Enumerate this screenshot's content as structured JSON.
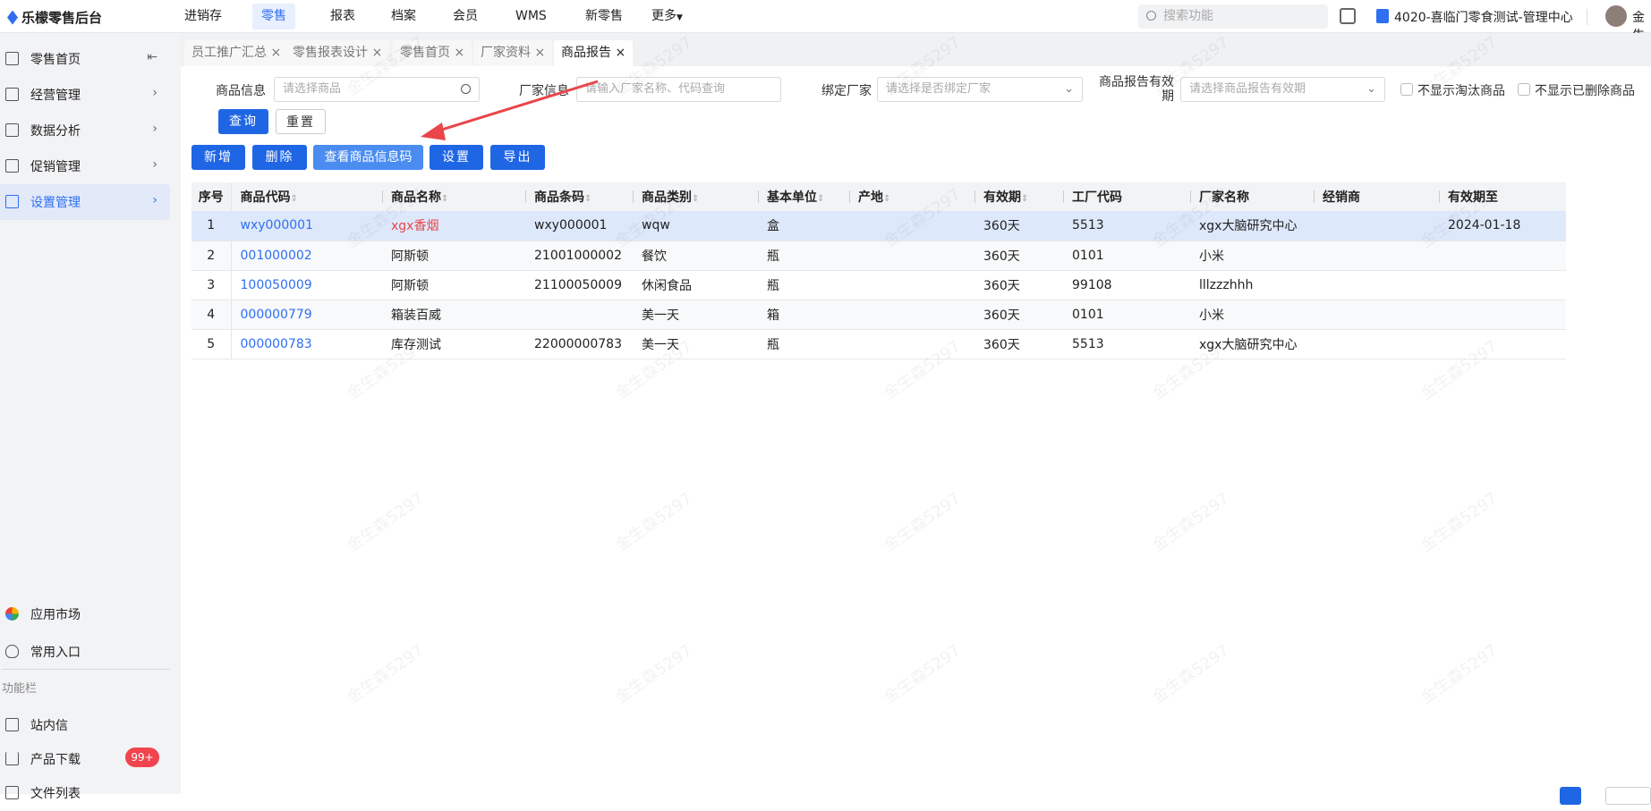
{
  "app": {
    "title": "乐檬零售后台"
  },
  "topnav": [
    "进销存",
    "零售",
    "报表",
    "档案",
    "会员",
    "WMS",
    "新零售",
    "更多"
  ],
  "topnav_active": 1,
  "header": {
    "search_placeholder": "搜索功能",
    "store": "4020-喜临门零食测试-管理中心",
    "user": "金生"
  },
  "sidebar": {
    "items": [
      "零售首页",
      "经营管理",
      "数据分析",
      "促销管理",
      "设置管理"
    ],
    "active": 4,
    "bottom": [
      "应用市场",
      "常用入口"
    ],
    "section": "功能栏",
    "tools": [
      "站内信",
      "产品下载",
      "文件列表"
    ],
    "badge": "99+"
  },
  "tabs": [
    {
      "label": "员工推广汇总"
    },
    {
      "label": "零售报表设计"
    },
    {
      "label": "零售首页"
    },
    {
      "label": "厂家资料"
    },
    {
      "label": "商品报告"
    }
  ],
  "filters": {
    "product_label": "商品信息",
    "product_placeholder": "请选择商品",
    "vendor_label": "厂家信息",
    "vendor_placeholder": "请输入厂家名称、代码查询",
    "bind_label": "绑定厂家",
    "bind_placeholder": "请选择是否绑定厂家",
    "validity_label": "商品报告有效期",
    "validity_placeholder": "请选择商品报告有效期",
    "hide_eliminated": "不显示淘汰商品",
    "hide_deleted": "不显示已删除商品",
    "query": "查询",
    "reset": "重置"
  },
  "actions": {
    "add": "新增",
    "delete": "删除",
    "view_code": "查看商品信息码",
    "settings": "设置",
    "export": "导出"
  },
  "table": {
    "columns": [
      "序号",
      "商品代码",
      "商品名称",
      "商品条码",
      "商品类别",
      "基本单位",
      "产地",
      "有效期",
      "工厂代码",
      "厂家名称",
      "经销商",
      "有效期至"
    ],
    "sortable": [
      false,
      true,
      true,
      true,
      true,
      true,
      true,
      true,
      false,
      false,
      false,
      false
    ],
    "rows": [
      [
        "1",
        "wxy000001",
        "xgx香烟",
        "wxy000001",
        "wqw",
        "盒",
        "",
        "360天",
        "5513",
        "xgx大脑研究中心",
        "",
        "2024-01-18"
      ],
      [
        "2",
        "001000002",
        "阿斯顿",
        "21001000002",
        "餐饮",
        "瓶",
        "",
        "360天",
        "0101",
        "小米",
        "",
        ""
      ],
      [
        "3",
        "100050009",
        "阿斯顿",
        "21100050009",
        "休闲食品",
        "瓶",
        "",
        "360天",
        "99108",
        "lllzzzhhh",
        "",
        ""
      ],
      [
        "4",
        "000000779",
        "箱装百威",
        "",
        "美一天",
        "箱",
        "",
        "360天",
        "0101",
        "小米",
        "",
        ""
      ],
      [
        "5",
        "000000783",
        "库存测试",
        "22000000783",
        "美一天",
        "瓶",
        "",
        "360天",
        "5513",
        "xgx大脑研究中心",
        "",
        ""
      ]
    ]
  },
  "watermark": "金生森5297",
  "colors": {
    "primary": "#1f66e5",
    "selected_row": "#dde8fb",
    "annotation_arrow": "#e8464a"
  }
}
